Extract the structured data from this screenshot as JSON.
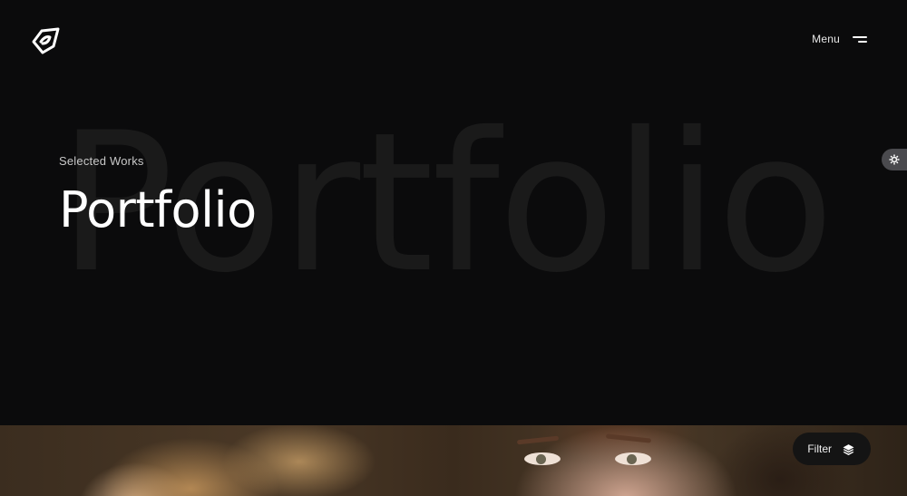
{
  "header": {
    "logo_icon": "brand-logo-icon",
    "menu_label": "Menu",
    "menu_icon": "hamburger-icon"
  },
  "hero": {
    "eyebrow": "Selected Works",
    "title": "Portfolio",
    "background_word": "Portfolio"
  },
  "sidebar_tab": {
    "icon": "gear-icon"
  },
  "filter": {
    "label": "Filter",
    "icon": "layers-icon"
  },
  "colors": {
    "background": "#0b0b0c",
    "background_word": "#1a1a1a",
    "title": "#ffffff",
    "eyebrow": "#c8c8c8",
    "settings_tab": "#4a4a4e",
    "filter_button": "#141414"
  }
}
